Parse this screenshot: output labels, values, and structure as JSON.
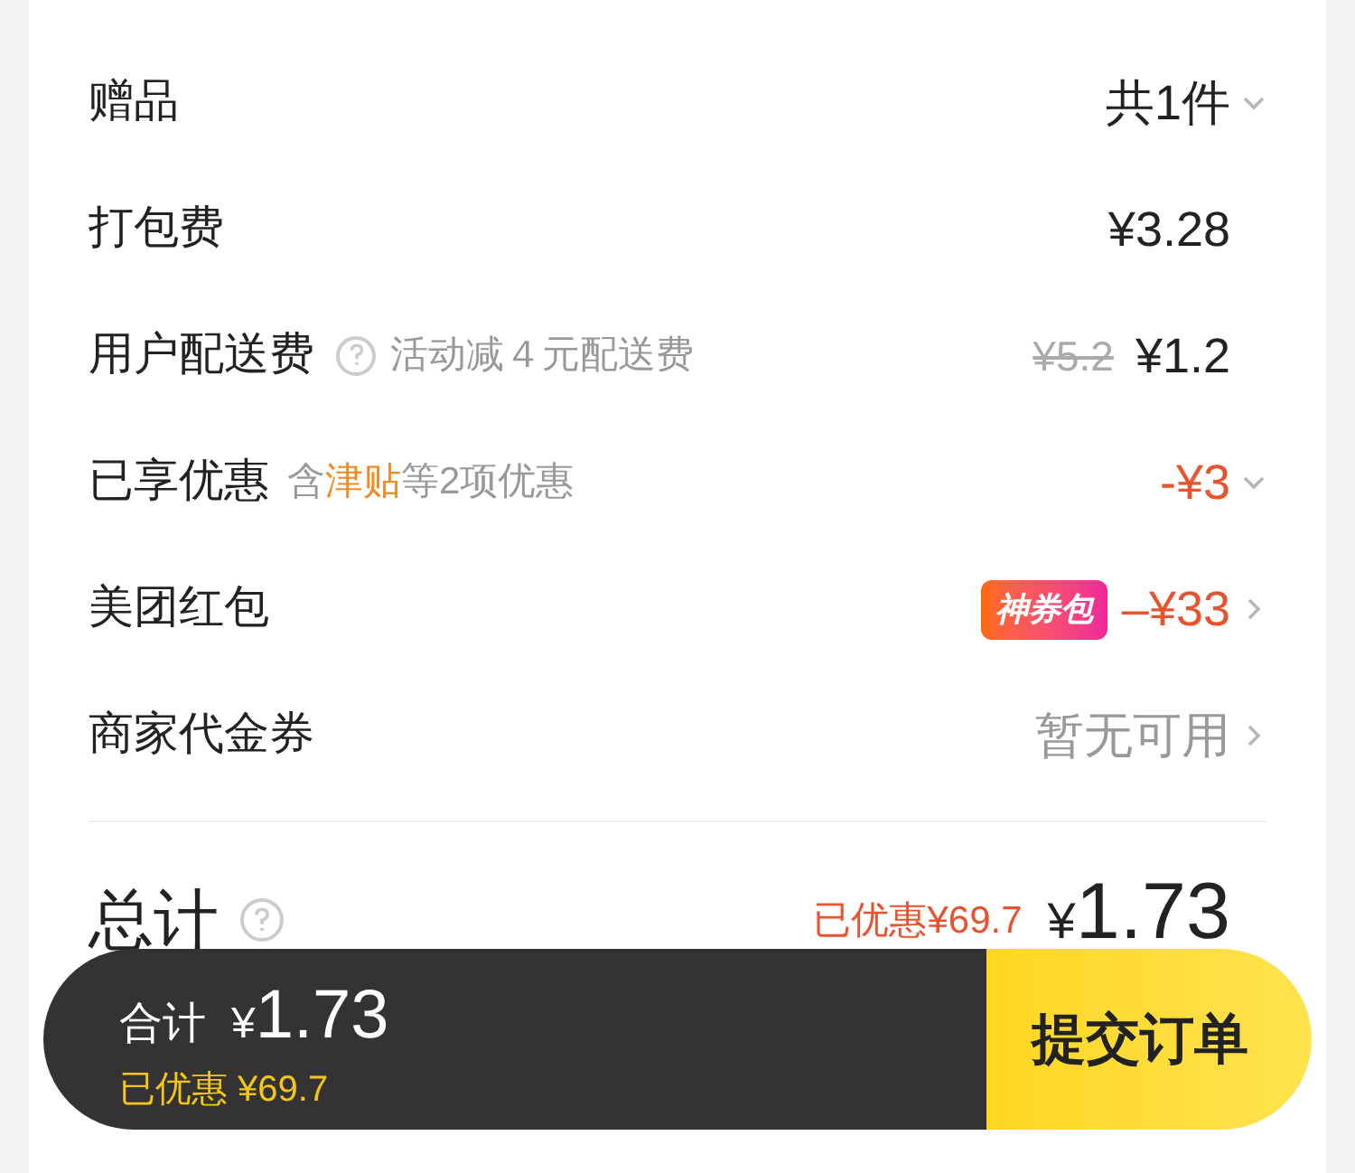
{
  "rows": [
    {
      "kind": "count",
      "label": "赠品",
      "value": "共1件"
    },
    {
      "kind": "price",
      "label": "打包费",
      "value": "¥3.28"
    },
    {
      "kind": "fee",
      "label": "用户配送费",
      "note": "活动减４元配送费",
      "old_value": "¥5.2",
      "value": "¥1.2"
    },
    {
      "kind": "discount",
      "label": "已享优惠",
      "note_parts": [
        "含",
        "津贴",
        "等2项优惠"
      ],
      "value": "-¥3"
    },
    {
      "kind": "coupon",
      "label": "美团红包",
      "badge": "神券包",
      "value": "–¥33"
    },
    {
      "kind": "unavailable",
      "label": "商家代金券",
      "value": "暂无可用"
    }
  ],
  "total": {
    "label": "总计",
    "saved": "已优惠¥69.7",
    "currency": "¥",
    "amount": "1.73"
  },
  "bottom_bar": {
    "label": "合计",
    "currency": "¥",
    "amount": "1.73",
    "saved": "已优惠 ¥69.7",
    "button": "提交订单"
  }
}
